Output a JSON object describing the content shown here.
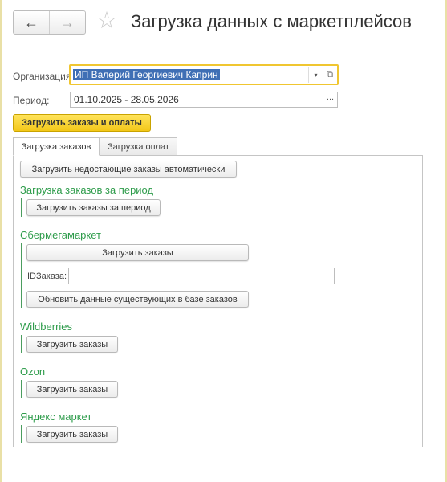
{
  "header": {
    "back_icon": "←",
    "forward_icon": "→",
    "favorite_icon": "☆",
    "title": "Загрузка данных с маркетплейсов"
  },
  "form": {
    "organization_label": "Организация:",
    "organization_value": "ИП Валерий Георгиевич Каприн",
    "dropdown_icon": "▾",
    "open_icon": "⧉",
    "period_label": "Период:",
    "period_value": "01.10.2025 - 28.05.2026",
    "period_select": "..."
  },
  "primary_button": "Загрузить заказы и оплаты",
  "tabs": [
    {
      "label": "Загрузка заказов",
      "active": true
    },
    {
      "label": "Загрузка оплат",
      "active": false
    }
  ],
  "panel": {
    "auto_load_button": "Загрузить недостающие заказы автоматически",
    "period_section": {
      "title": "Загрузка заказов за период",
      "button": "Загрузить заказы за период"
    },
    "sber": {
      "title": "Сбермегамаркет",
      "load_button": "Загрузить заказы",
      "id_label": "IDЗаказа:",
      "id_value": "",
      "update_button": "Обновить данные существующих в базе заказов"
    },
    "wildberries": {
      "title": "Wildberries",
      "button": "Загрузить заказы"
    },
    "ozon": {
      "title": "Ozon",
      "button": "Загрузить заказы"
    },
    "yandex": {
      "title": "Яндекс маркет",
      "button": "Загрузить заказы"
    }
  },
  "colors": {
    "accent_yellow": "#f3c718",
    "section_green": "#2e9c4b",
    "selection_blue": "#3f6fb5"
  }
}
